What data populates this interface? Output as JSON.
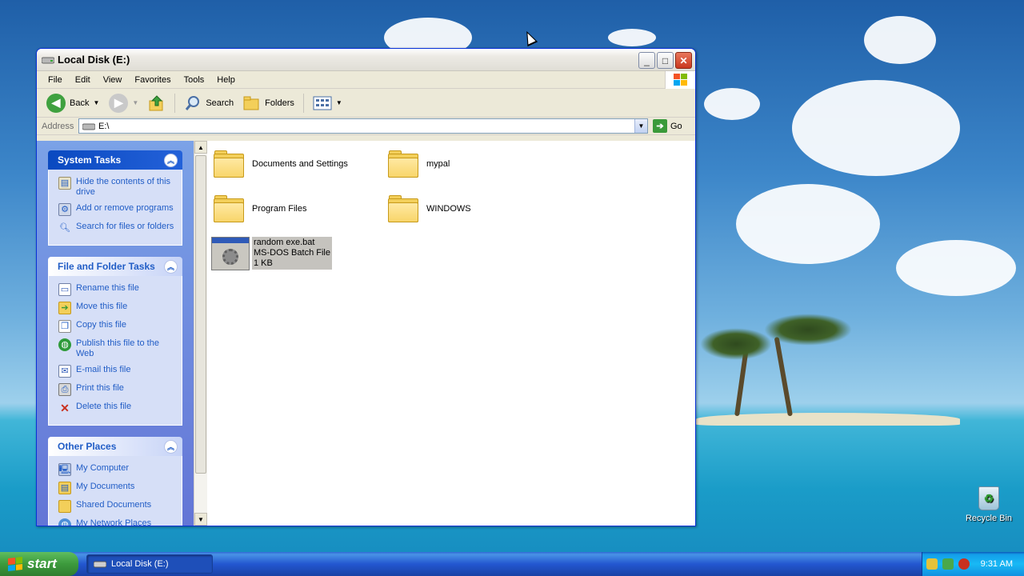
{
  "window": {
    "title": "Local Disk (E:)",
    "minimize_label": "_",
    "maximize_label": "□",
    "close_label": "✕"
  },
  "menubar": {
    "items": [
      "File",
      "Edit",
      "View",
      "Favorites",
      "Tools",
      "Help"
    ]
  },
  "toolbar": {
    "back_label": "Back",
    "search_label": "Search",
    "folders_label": "Folders"
  },
  "address": {
    "label": "Address",
    "value": "E:\\",
    "go_label": "Go"
  },
  "system_tasks": {
    "title": "System Tasks",
    "items": [
      {
        "label": "Hide the contents of this drive",
        "icon": "hide-drive-icon"
      },
      {
        "label": "Add or remove programs",
        "icon": "add-remove-icon"
      },
      {
        "label": "Search for files or folders",
        "icon": "search-icon"
      }
    ]
  },
  "file_tasks": {
    "title": "File and Folder Tasks",
    "items": [
      {
        "label": "Rename this file",
        "icon": "rename-icon"
      },
      {
        "label": "Move this file",
        "icon": "move-icon"
      },
      {
        "label": "Copy this file",
        "icon": "copy-icon"
      },
      {
        "label": "Publish this file to the Web",
        "icon": "globe-icon"
      },
      {
        "label": "E-mail this file",
        "icon": "email-icon"
      },
      {
        "label": "Print this file",
        "icon": "printer-icon"
      },
      {
        "label": "Delete this file",
        "icon": "delete-icon"
      }
    ]
  },
  "other_places": {
    "title": "Other Places",
    "items": [
      {
        "label": "My Computer",
        "icon": "computer-icon"
      },
      {
        "label": "My Documents",
        "icon": "documents-icon"
      },
      {
        "label": "Shared Documents",
        "icon": "folder-icon"
      },
      {
        "label": "My Network Places",
        "icon": "network-icon"
      }
    ]
  },
  "files": {
    "folders": [
      "Documents and Settings",
      "mypal",
      "Program Files",
      "WINDOWS"
    ],
    "selected": {
      "name": "random exe.bat",
      "type": "MS-DOS Batch File",
      "size": "1 KB"
    }
  },
  "desktop": {
    "recycle_label": "Recycle Bin"
  },
  "taskbar": {
    "start_label": "start",
    "task_label": "Local Disk (E:)",
    "clock": "9:31 AM"
  },
  "colors": {
    "title_blue": "#0831d9",
    "link_blue": "#215dc6",
    "start_green": "#3c9a3c",
    "taskbar_blue": "#2357d0"
  }
}
